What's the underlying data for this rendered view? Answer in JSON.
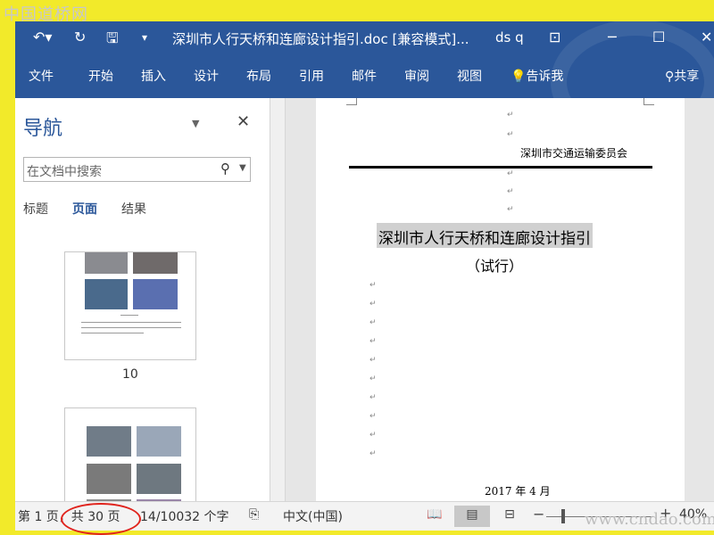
{
  "watermark": {
    "top": "中国道桥网",
    "bottom": "www.cndao.com"
  },
  "titlebar": {
    "title": "深圳市人行天桥和连廊设计指引.doc [兼容模式]...",
    "user": "ds q",
    "icons": [
      "undo-icon",
      "redo-icon",
      "save-icon",
      "customize-icon",
      "ribbon-options-icon",
      "minimize-icon",
      "maximize-icon",
      "close-icon"
    ]
  },
  "ribbon": {
    "tabs": [
      "文件",
      "开始",
      "插入",
      "设计",
      "布局",
      "引用",
      "邮件",
      "审阅",
      "视图"
    ],
    "tell_me": "告诉我",
    "share": "共享"
  },
  "nav": {
    "title": "导航",
    "search_placeholder": "在文档中搜索",
    "tabs": [
      "标题",
      "页面",
      "结果"
    ],
    "active_tab": "页面",
    "pages": [
      {
        "label": "10"
      },
      {
        "label": ""
      }
    ]
  },
  "document": {
    "org": "深圳市交通运输委员会",
    "title": "深圳市人行天桥和连廊设计指引",
    "subtitle": "（试行）",
    "date": "2017 年 4 月"
  },
  "status": {
    "page": "第 1 页，共 30 页",
    "words": "14/10032 个字",
    "language": "中文(中国)",
    "zoom": "40%",
    "zoom_level": 0.4
  },
  "colors": {
    "accent": "#2b579a",
    "highlight": "#e0231c"
  }
}
